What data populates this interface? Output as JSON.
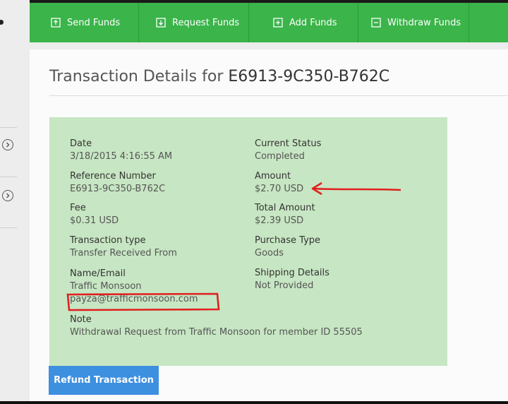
{
  "nav": {
    "items": [
      {
        "label": "Send Funds",
        "icon": "send-funds-icon"
      },
      {
        "label": "Request Funds",
        "icon": "request-funds-icon"
      },
      {
        "label": "Add Funds",
        "icon": "add-funds-icon"
      },
      {
        "label": "Withdraw Funds",
        "icon": "withdraw-funds-icon"
      }
    ]
  },
  "page": {
    "title_prefix": "Transaction Details for",
    "reference": "E6913-9C350-B762C"
  },
  "details": {
    "date": {
      "label": "Date",
      "value": "3/18/2015 4:16:55 AM"
    },
    "reference_number": {
      "label": "Reference Number",
      "value": "E6913-9C350-B762C"
    },
    "fee": {
      "label": "Fee",
      "value": "$0.31 USD"
    },
    "transaction_type": {
      "label": "Transaction type",
      "value": "Transfer Received From"
    },
    "name_email": {
      "label": "Name/Email",
      "name": "Traffic Monsoon",
      "email": "payza@trafficmonsoon.com"
    },
    "note": {
      "label": "Note",
      "value": "Withdrawal Request from Traffic Monsoon for member ID 55505"
    },
    "current_status": {
      "label": "Current Status",
      "value": "Completed"
    },
    "amount": {
      "label": "Amount",
      "value": "$2.70 USD"
    },
    "total_amount": {
      "label": "Total Amount",
      "value": "$2.39 USD"
    },
    "purchase_type": {
      "label": "Purchase Type",
      "value": "Goods"
    },
    "shipping_details": {
      "label": "Shipping Details",
      "value": "Not Provided"
    }
  },
  "actions": {
    "refund_label": "Refund Transaction"
  },
  "colors": {
    "nav_green": "#3bb44a",
    "panel_green": "#c7e6c3",
    "button_blue": "#3d8fe0",
    "annotation_red": "#e02020"
  }
}
